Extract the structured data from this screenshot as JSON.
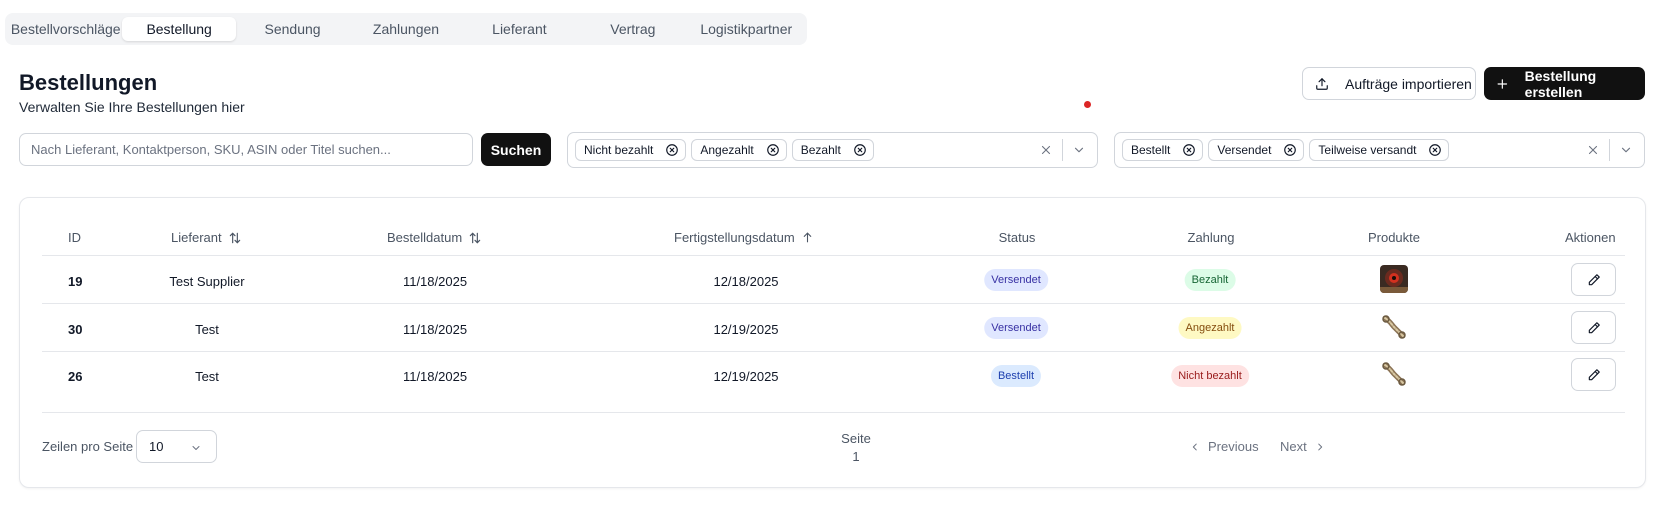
{
  "tabs": [
    {
      "label": "Bestellvorschläge",
      "active": false
    },
    {
      "label": "Bestellung",
      "active": true
    },
    {
      "label": "Sendung",
      "active": false
    },
    {
      "label": "Zahlungen",
      "active": false
    },
    {
      "label": "Lieferant",
      "active": false
    },
    {
      "label": "Vertrag",
      "active": false
    },
    {
      "label": "Logistikpartner",
      "active": false
    }
  ],
  "header": {
    "title": "Bestellungen",
    "subtitle": "Verwalten Sie Ihre Bestellungen hier",
    "import_label": "Aufträge importieren",
    "create_label": "Bestellung erstellen"
  },
  "search": {
    "placeholder": "Nach Lieferant, Kontaktperson, SKU, ASIN oder Titel suchen...",
    "value": "",
    "button_label": "Suchen"
  },
  "payment_filter": {
    "chips": [
      "Nicht bezahlt",
      "Angezahlt",
      "Bezahlt"
    ]
  },
  "status_filter": {
    "chips": [
      "Bestellt",
      "Versendet",
      "Teilweise versandt"
    ]
  },
  "table": {
    "columns": [
      "ID",
      "Lieferant",
      "Bestelldatum",
      "Fertigstellungsdatum",
      "Status",
      "Zahlung",
      "Produkte",
      "Aktionen"
    ],
    "rows": [
      {
        "id": "19",
        "supplier": "Test Supplier",
        "order_date": "11/18/2025",
        "completion_date": "12/18/2025",
        "status": "Versendet",
        "payment": "Bezahlt",
        "product_icon": "dark-product-thumbnail"
      },
      {
        "id": "30",
        "supplier": "Test",
        "order_date": "11/18/2025",
        "completion_date": "12/19/2025",
        "status": "Versendet",
        "payment": "Angezahlt",
        "product_icon": "rope-product-thumbnail"
      },
      {
        "id": "26",
        "supplier": "Test",
        "order_date": "11/18/2025",
        "completion_date": "12/19/2025",
        "status": "Bestellt",
        "payment": "Nicht bezahlt",
        "product_icon": "rope-product-thumbnail"
      }
    ]
  },
  "pagination": {
    "rows_label": "Zeilen pro Seite",
    "rows_value": "10",
    "page_label": "Seite",
    "page_number": "1",
    "prev_label": "Previous",
    "next_label": "Next"
  },
  "colors": {
    "primary": "#111111",
    "notification_dot": "#dc2626"
  }
}
